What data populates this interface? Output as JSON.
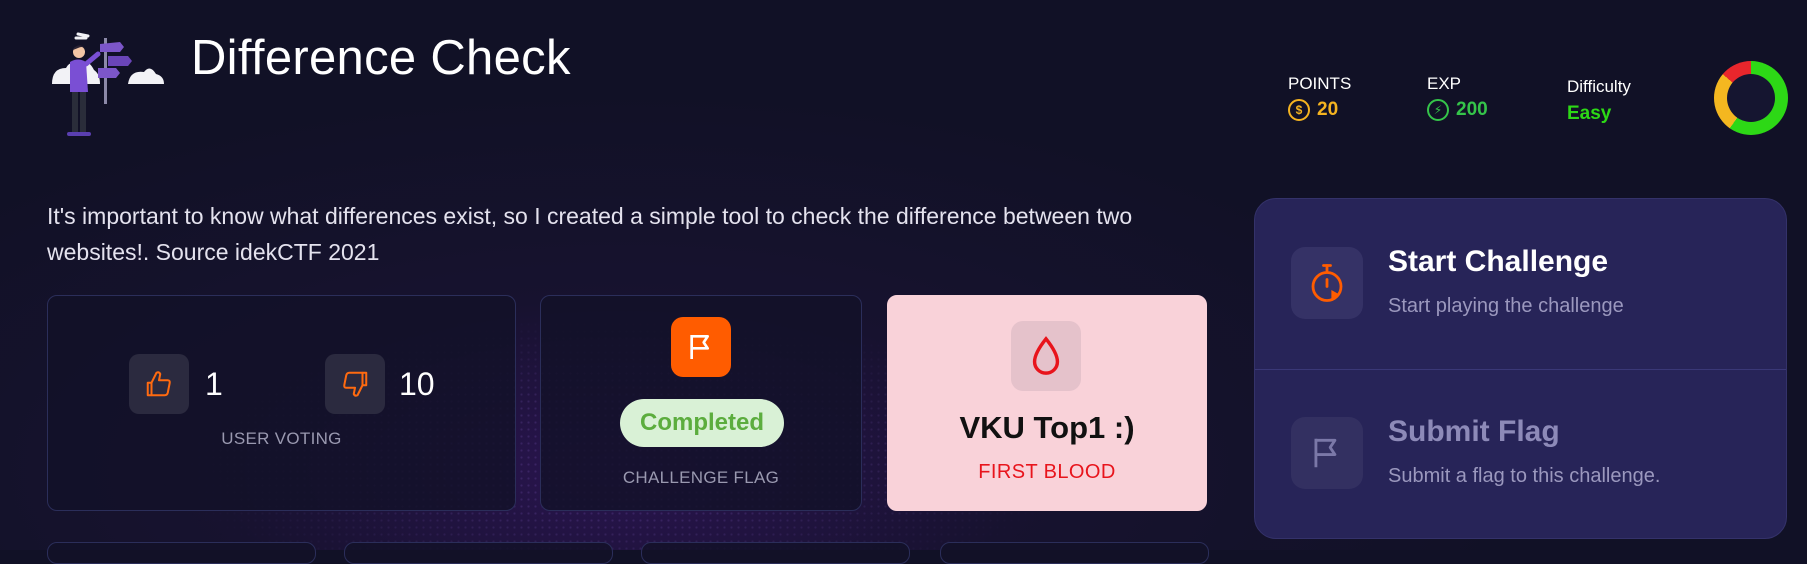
{
  "challenge": {
    "title": "Difference Check",
    "description": "It's important to know what differences exist, so I created a simple tool to check the difference between two websites!. Source idekCTF 2021"
  },
  "stats": {
    "points_label": "POINTS",
    "points_value": "20",
    "exp_label": "EXP",
    "exp_value": "200",
    "difficulty_label": "Difficulty",
    "difficulty_value": "Easy"
  },
  "colors": {
    "accent_orange": "#ff5c00",
    "points_gold": "#f4b320",
    "exp_green": "#35c44a",
    "easy_green": "#2dd816",
    "first_blood_red": "#e8141c"
  },
  "voting": {
    "likes": "1",
    "dislikes": "10",
    "caption": "USER VOTING"
  },
  "flag_status": {
    "status": "Completed",
    "caption": "CHALLENGE FLAG"
  },
  "first_blood": {
    "name": "VKU Top1 :)",
    "caption": "FIRST BLOOD"
  },
  "actions": {
    "start_title": "Start Challenge",
    "start_sub": "Start playing the challenge",
    "submit_title": "Submit Flag",
    "submit_sub": "Submit a flag to this challenge."
  },
  "icons": {
    "logo": "person-with-signpost-illustration",
    "points": "coin-icon",
    "exp": "exp-icon",
    "like": "thumbs-up-icon",
    "dislike": "thumbs-down-icon",
    "flag": "flag-icon",
    "blood": "blood-drop-icon",
    "timer": "stopwatch-icon"
  }
}
